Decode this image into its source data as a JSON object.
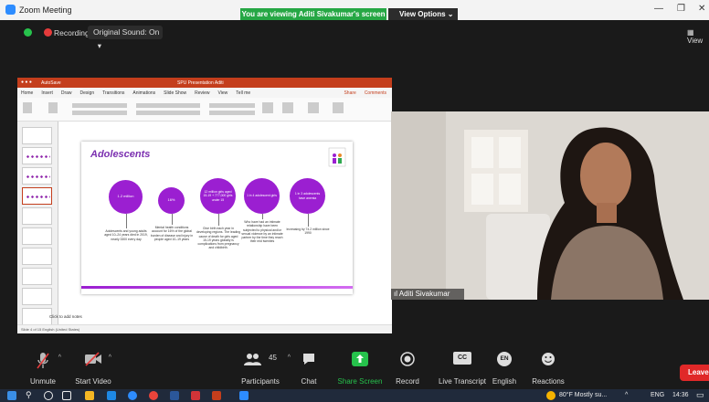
{
  "window": {
    "title": "Zoom Meeting"
  },
  "banner": {
    "text": "You are viewing Aditi Sivakumar's screen",
    "view_options": "View Options"
  },
  "topbar": {
    "recording_label": "Recording",
    "sound_label": "Original Sound: On",
    "view_label": "View"
  },
  "ppt": {
    "window_title": "SPU Presentation Aditi",
    "autosave": "AutoSave",
    "menu": [
      "Home",
      "Insert",
      "Draw",
      "Design",
      "Transitions",
      "Animations",
      "Slide Show",
      "Review",
      "View",
      "Tell me"
    ],
    "share_label": "Share",
    "comments_label": "Comments",
    "notes_placeholder": "Click to add notes",
    "status_text": "Slide 4 of 15   English (United States)"
  },
  "slide": {
    "title": "Adolescents",
    "stats": [
      {
        "circle": "1.2 million",
        "desc": "Adolescents and young adults aged 10–24 years died in 2019, nearly 3300 every day"
      },
      {
        "circle": "16%",
        "desc": "Mental health conditions account for 16% of the global burden of disease and injury in people aged 10–19 years"
      },
      {
        "circle": "12 million girls aged 15-19 + 777,000 girls under 15",
        "desc": "Give birth each year in developing regions. The leading cause of death for girls aged 15-19 years globally is complications from pregnancy and childbirth."
      },
      {
        "circle": "1 in 4 adolescent girls",
        "desc": "Who have had an intimate relationship have been subjected to physical and/or sexual violence by an intimate partner by the time they reach their mid twenties"
      },
      {
        "circle": "1 in 3 adolescents have anemia",
        "desc": "Increasing by 74.2 million since 1990"
      }
    ]
  },
  "video": {
    "participant_name": "Aditi Sivakumar"
  },
  "toolbar": {
    "unmute": "Unmute",
    "start_video": "Start Video",
    "participants": "Participants",
    "participant_count": "45",
    "chat": "Chat",
    "share_screen": "Share Screen",
    "record": "Record",
    "live_transcript": "Live Transcript",
    "english": "English",
    "english_badge": "EN",
    "cc_badge": "CC",
    "reactions": "Reactions",
    "leave": "Leave"
  },
  "taskbar": {
    "weather": "80°F  Mostly su...",
    "language": "ENG",
    "time": "14:36"
  },
  "colors": {
    "zoom_blue": "#2d8cff",
    "banner_green": "#26a744",
    "share_green": "#26c24c",
    "leave_red": "#e02828",
    "slide_purple": "#9b1fd1"
  }
}
